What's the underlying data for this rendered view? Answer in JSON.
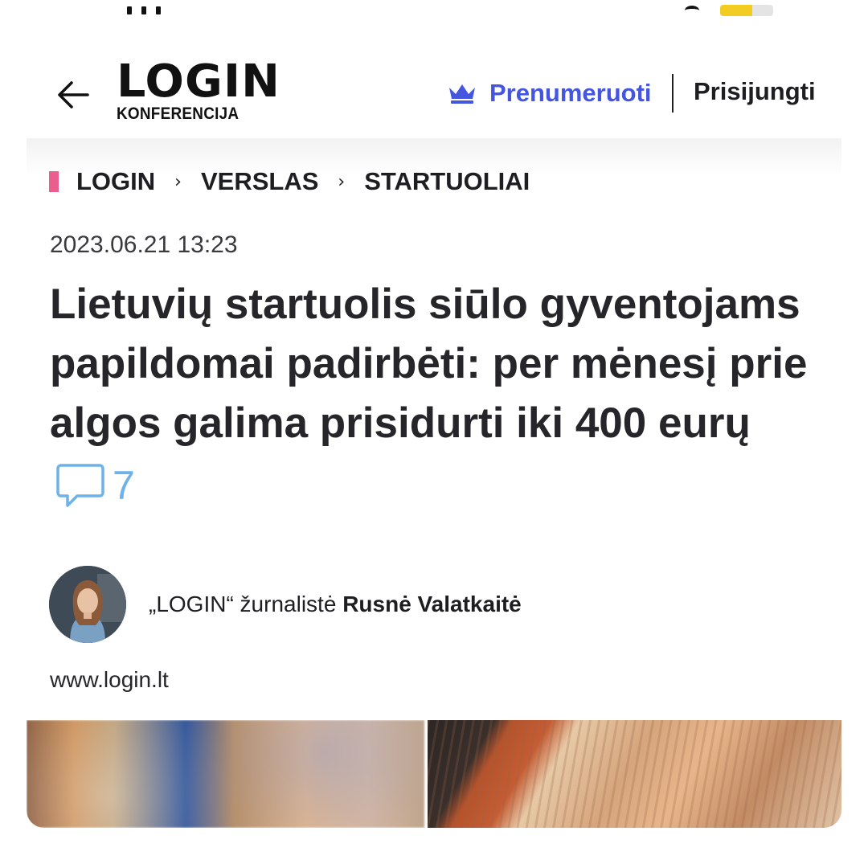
{
  "header": {
    "logo_word": "LOGIN",
    "logo_sub": "KONFERENCIJA",
    "subscribe_label": "Prenumeruoti",
    "login_label": "Prisijungti"
  },
  "breadcrumb": {
    "items": [
      {
        "label": "LOGIN"
      },
      {
        "label": "VERSLAS"
      },
      {
        "label": "STARTUOLIAI"
      }
    ],
    "separator": "›"
  },
  "article": {
    "date": "2023.06.21 13:23",
    "title": "Lietuvių startuolis siūlo gyventojams papildomai padirbėti: per mėnesį prie algos galima prisidurti iki 400 eurų",
    "comment_count": "7",
    "author_prefix": "„LOGIN“ žurnalistė",
    "author_name": "Rusnė Valatkaitė",
    "source": "www.login.lt"
  },
  "icons": {
    "back": "arrow-left-icon",
    "subscribe": "crown-icon",
    "comments": "speech-bubble-icon"
  },
  "colors": {
    "accent_blue": "#4456e0",
    "breadcrumb_mark": "#ea5e8d",
    "comment_blue": "#6fb2e8",
    "text": "#1e1e22"
  }
}
